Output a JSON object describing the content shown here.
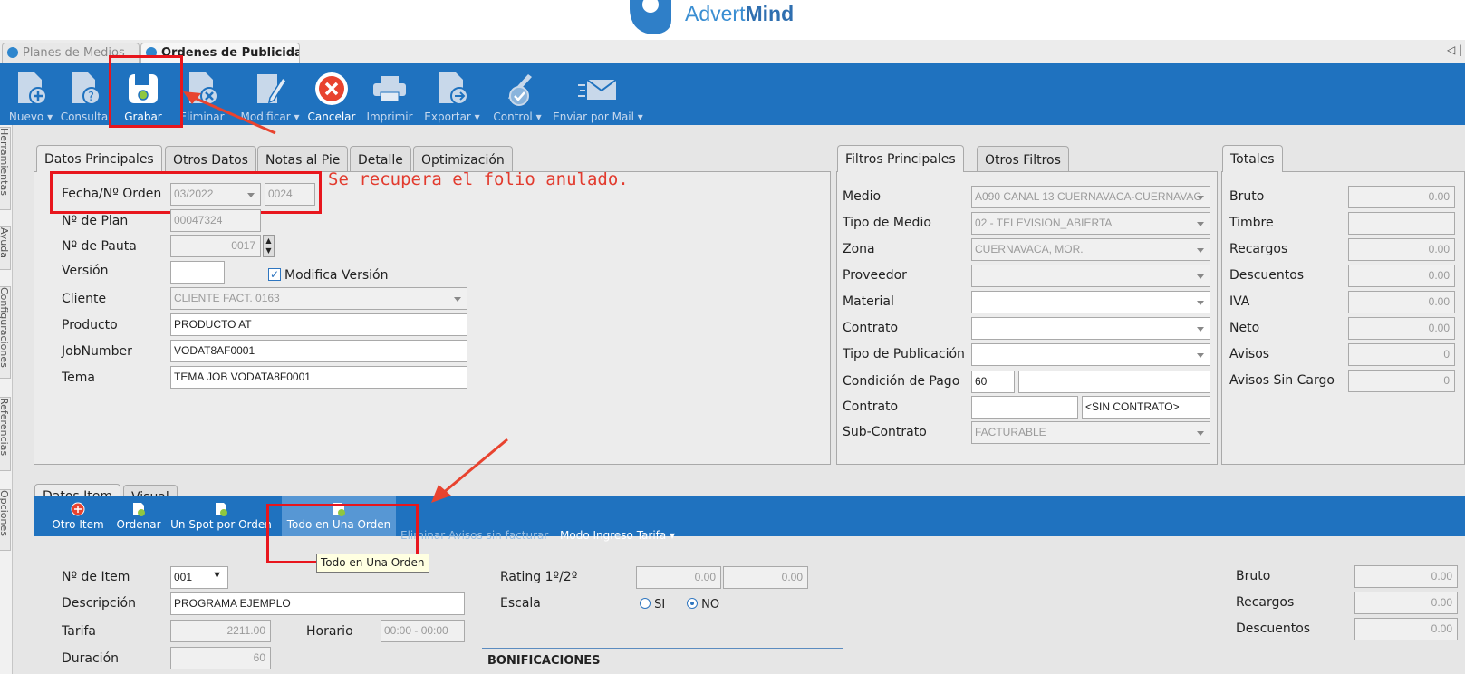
{
  "brand": {
    "name_a": "Advert",
    "name_b": "Mind"
  },
  "app_tabs": [
    {
      "label": "Planes de Medios"
    },
    {
      "label": "Ordenes de Publicidad"
    }
  ],
  "toolbar": [
    {
      "label": "Nuevo",
      "dropdown": true
    },
    {
      "label": "Consulta"
    },
    {
      "label": "Grabar"
    },
    {
      "label": "Eliminar"
    },
    {
      "label": "Modificar",
      "dropdown": true
    },
    {
      "label": "Cancelar"
    },
    {
      "label": "Imprimir"
    },
    {
      "label": "Exportar",
      "dropdown": true
    },
    {
      "label": "Control",
      "dropdown": true
    },
    {
      "label": "Enviar por Mail",
      "dropdown": true
    }
  ],
  "side_tabs": [
    "Herramientas",
    "Ayuda",
    "Configuraciones",
    "Referencias",
    "Opciones"
  ],
  "main_tabs": [
    "Datos Principales",
    "Otros Datos",
    "Notas al Pie",
    "Detalle",
    "Optimización"
  ],
  "principal": {
    "fecha_label": "Fecha/Nº Orden",
    "fecha_value": "03/2022",
    "orden_value": "0024",
    "plan_label": "Nº de Plan",
    "plan_value": "00047324",
    "pauta_label": "Nº de Pauta",
    "pauta_value": "0017",
    "version_label": "Versión",
    "version_value": "",
    "modifica_label": "Modifica Versión",
    "modifica_checked": true,
    "cliente_label": "Cliente",
    "cliente_value": "CLIENTE FACT. 0163",
    "producto_label": "Producto",
    "producto_value": "PRODUCTO AT",
    "job_label": "JobNumber",
    "job_value": "VODAT8AF0001",
    "tema_label": "Tema",
    "tema_value": "TEMA JOB VODATA8F0001"
  },
  "annotation": "Se recupera el folio anulado.",
  "filter_tabs": [
    "Filtros Principales",
    "Otros Filtros"
  ],
  "filtros": {
    "medio_label": "Medio",
    "medio_value": "A090 CANAL 13 CUERNAVACA-CUERNAVAC",
    "tipo_medio_label": "Tipo de Medio",
    "tipo_medio_value": "02 - TELEVISION_ABIERTA",
    "zona_label": "Zona",
    "zona_value": "CUERNAVACA, MOR.",
    "proveedor_label": "Proveedor",
    "proveedor_value": "",
    "material_label": "Material",
    "material_value": "",
    "contrato_label": "Contrato",
    "contrato_value": "",
    "tipo_pub_label": "Tipo de Publicación",
    "tipo_pub_value": "",
    "condicion_label": "Condición de Pago",
    "condicion_value": "60",
    "condicion_desc": "",
    "contrato2_label": "Contrato",
    "contrato2_value": "",
    "contrato2_desc": "<SIN CONTRATO>",
    "subcontrato_label": "Sub-Contrato",
    "subcontrato_value": "FACTURABLE"
  },
  "totales_tab": "Totales",
  "totales": [
    {
      "label": "Bruto",
      "value": "0.00"
    },
    {
      "label": "Timbre",
      "value": ""
    },
    {
      "label": "Recargos",
      "value": "0.00"
    },
    {
      "label": "Descuentos",
      "value": "0.00"
    },
    {
      "label": "IVA",
      "value": "0.00"
    },
    {
      "label": "Neto",
      "value": "0.00"
    },
    {
      "label": "Avisos",
      "value": "0"
    },
    {
      "label": "Avisos Sin Cargo",
      "value": "0"
    }
  ],
  "item_tabs": [
    "Datos Item",
    "Visual"
  ],
  "item_toolbar": {
    "otro_item": "Otro Item",
    "ordenar": "Ordenar",
    "un_spot": "Un Spot por Orden",
    "todo": "Todo en Una Orden",
    "eliminar_avisos": "Eliminar Avisos sin facturar",
    "modo_ingreso": "Modo Ingreso Tarifa",
    "tooltip": "Todo en Una Orden"
  },
  "item": {
    "nro_label": "Nº de Item",
    "nro_value": "001",
    "desc_label": "Descripción",
    "desc_value": "PROGRAMA EJEMPLO",
    "tarifa_label": "Tarifa",
    "tarifa_value": "2211.00",
    "horario_label": "Horario",
    "horario_value": "00:00 - 00:00",
    "duracion_label": "Duración",
    "duracion_value": "60",
    "rating_label": "Rating 1º/2º",
    "rating1": "0.00",
    "rating2": "0.00",
    "escala_label": "Escala",
    "si_label": "SI",
    "no_label": "NO",
    "escala_selected": "NO",
    "bonificaciones": "BONIFICACIONES"
  },
  "item_totales": [
    {
      "label": "Bruto",
      "value": "0.00"
    },
    {
      "label": "Recargos",
      "value": "0.00"
    },
    {
      "label": "Descuentos",
      "value": "0.00"
    }
  ],
  "colors": {
    "toolbar_blue": "#1f72bf",
    "annotation_red": "#e8161d"
  }
}
